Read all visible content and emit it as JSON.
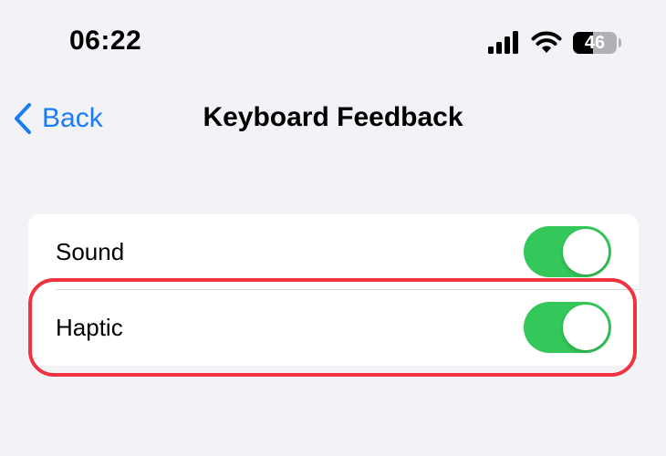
{
  "status_bar": {
    "time": "06:22",
    "battery_level": "46",
    "battery_fraction": 0.46,
    "icons": [
      "signal-icon",
      "wifi-icon",
      "battery-icon"
    ]
  },
  "nav": {
    "back_label": "Back",
    "title": "Keyboard Feedback"
  },
  "settings": {
    "items": [
      {
        "label": "Sound",
        "enabled": true
      },
      {
        "label": "Haptic",
        "enabled": true
      }
    ]
  },
  "colors": {
    "accent": "#1a7cf5",
    "toggle_on": "#34c759",
    "highlight": "#ef3340",
    "background": "#f2f2f7"
  }
}
